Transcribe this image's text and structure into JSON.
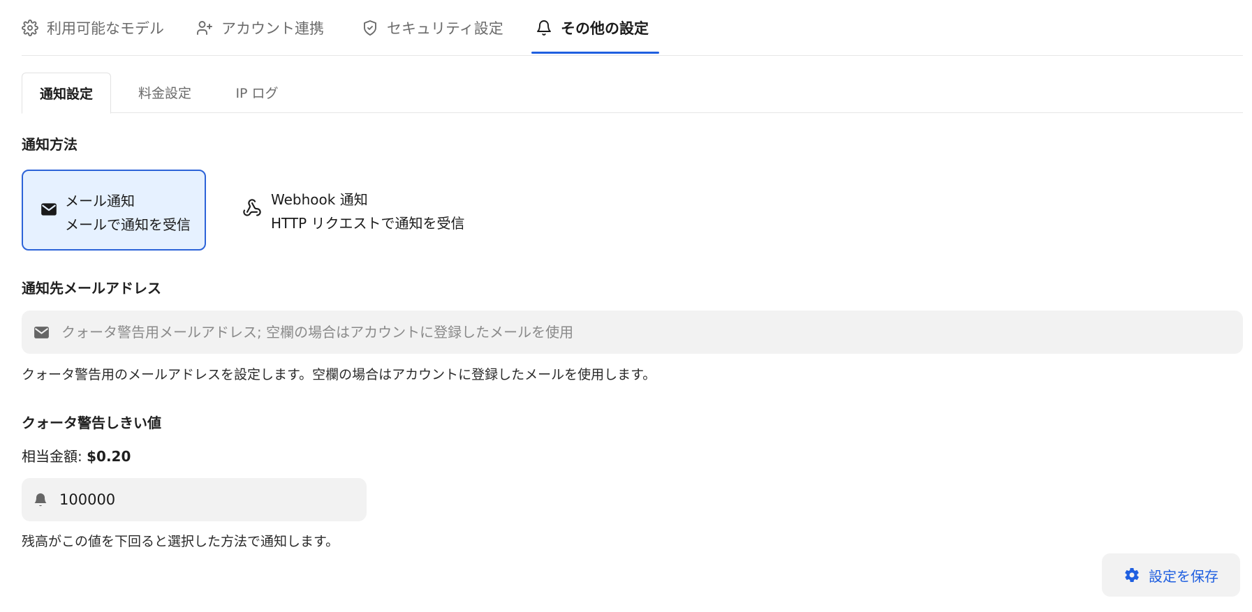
{
  "top_tabs": [
    {
      "label": "利用可能なモデル",
      "icon": "gear-icon"
    },
    {
      "label": "アカウント連携",
      "icon": "user-plus-icon"
    },
    {
      "label": "セキュリティ設定",
      "icon": "shield-check-icon"
    },
    {
      "label": "その他の設定",
      "icon": "bell-icon",
      "active": true
    }
  ],
  "sub_tabs": [
    {
      "label": "通知設定",
      "active": true
    },
    {
      "label": "料金設定"
    },
    {
      "label": "IP ログ"
    }
  ],
  "notification_method": {
    "title": "通知方法",
    "options": [
      {
        "title": "メール通知",
        "description": "メールで通知を受信",
        "icon": "envelope-icon",
        "selected": true
      },
      {
        "title": "Webhook 通知",
        "description": "HTTP リクエストで通知を受信",
        "icon": "webhook-icon",
        "selected": false
      }
    ]
  },
  "email": {
    "title": "通知先メールアドレス",
    "placeholder": "クォータ警告用メールアドレス; 空欄の場合はアカウントに登録したメールを使用",
    "value": "",
    "help": "クォータ警告用のメールアドレスを設定します。空欄の場合はアカウントに登録したメールを使用します。"
  },
  "threshold": {
    "title": "クォータ警告しきい値",
    "equiv_label": "相当金額:",
    "equiv_amount": "$0.20",
    "value": "100000",
    "help": "残高がこの値を下回ると選択した方法で通知します。"
  },
  "save_button": {
    "label": "設定を保存",
    "icon": "gear-icon"
  },
  "colors": {
    "accent": "#1f5fe0",
    "selected_bg": "#e6f1ff",
    "input_bg": "#f2f2f2"
  }
}
